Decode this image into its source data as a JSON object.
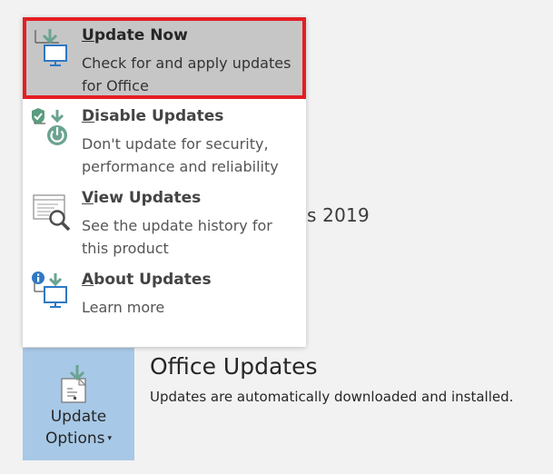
{
  "background": {
    "partial_product_text": "s 2019"
  },
  "menu": {
    "items": [
      {
        "title_first": "U",
        "title_rest": "pdate Now",
        "description": "Check for and apply updates for Office",
        "icon": "update-now-icon"
      },
      {
        "title_first": "D",
        "title_rest": "isable Updates",
        "description": "Don't update for security, performance and reliability",
        "icon": "disable-updates-icon"
      },
      {
        "title_first": "V",
        "title_rest": "iew Updates",
        "description": "See the update history for this product",
        "icon": "view-updates-icon"
      },
      {
        "title_first": "A",
        "title_rest": "bout Updates",
        "description": "Learn more",
        "icon": "about-updates-icon"
      }
    ]
  },
  "update_options": {
    "label_line1": "Update",
    "label_line2": "Options",
    "caret": "▾"
  },
  "office_updates": {
    "title": "Office Updates",
    "description": "Updates are automatically downloaded and installed."
  },
  "colors": {
    "highlight_border": "#e31e24",
    "highlight_bg": "#c6c6c6",
    "tile_bg": "#a7c8e6",
    "icon_green": "#6ba391",
    "icon_blue": "#2f78c4"
  }
}
